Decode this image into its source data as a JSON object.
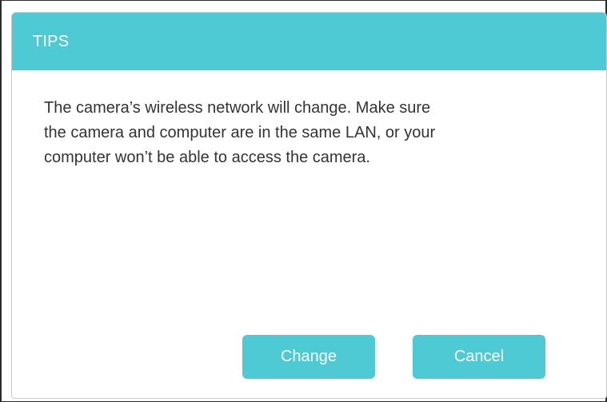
{
  "dialog": {
    "title": "TIPS",
    "message_line1": "The camera’s wireless network will change. Make sure",
    "message_line2": "the camera and computer are in the same LAN, or your",
    "message_line3": "computer won’t be able to access the camera.",
    "change_label": "Change",
    "cancel_label": "Cancel"
  },
  "colors": {
    "accent": "#4dcad3",
    "text": "#333333"
  }
}
